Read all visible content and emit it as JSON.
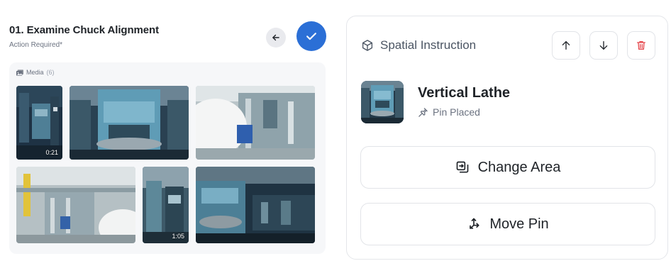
{
  "step": {
    "title": "01. Examine Chuck Alignment",
    "subtitle": "Action Required*"
  },
  "actions": {
    "back_icon": "arrow-left-icon",
    "confirm_icon": "check-icon",
    "confirm_color": "#2b6fd6"
  },
  "media": {
    "label": "Media",
    "count": "(6)",
    "items": [
      {
        "type": "video",
        "duration": "0:21"
      },
      {
        "type": "image"
      },
      {
        "type": "image"
      },
      {
        "type": "image"
      },
      {
        "type": "video",
        "duration": "1:05"
      },
      {
        "type": "image"
      }
    ]
  },
  "spatial": {
    "heading": "Spatial Instruction",
    "icons": [
      "cube-icon",
      "arrow-up-icon",
      "arrow-down-icon",
      "trash-icon"
    ],
    "delete_color": "#e5484d",
    "location": {
      "name": "Vertical Lathe",
      "pin_status": "Pin Placed"
    },
    "change_area_label": "Change Area",
    "move_pin_label": "Move Pin"
  }
}
